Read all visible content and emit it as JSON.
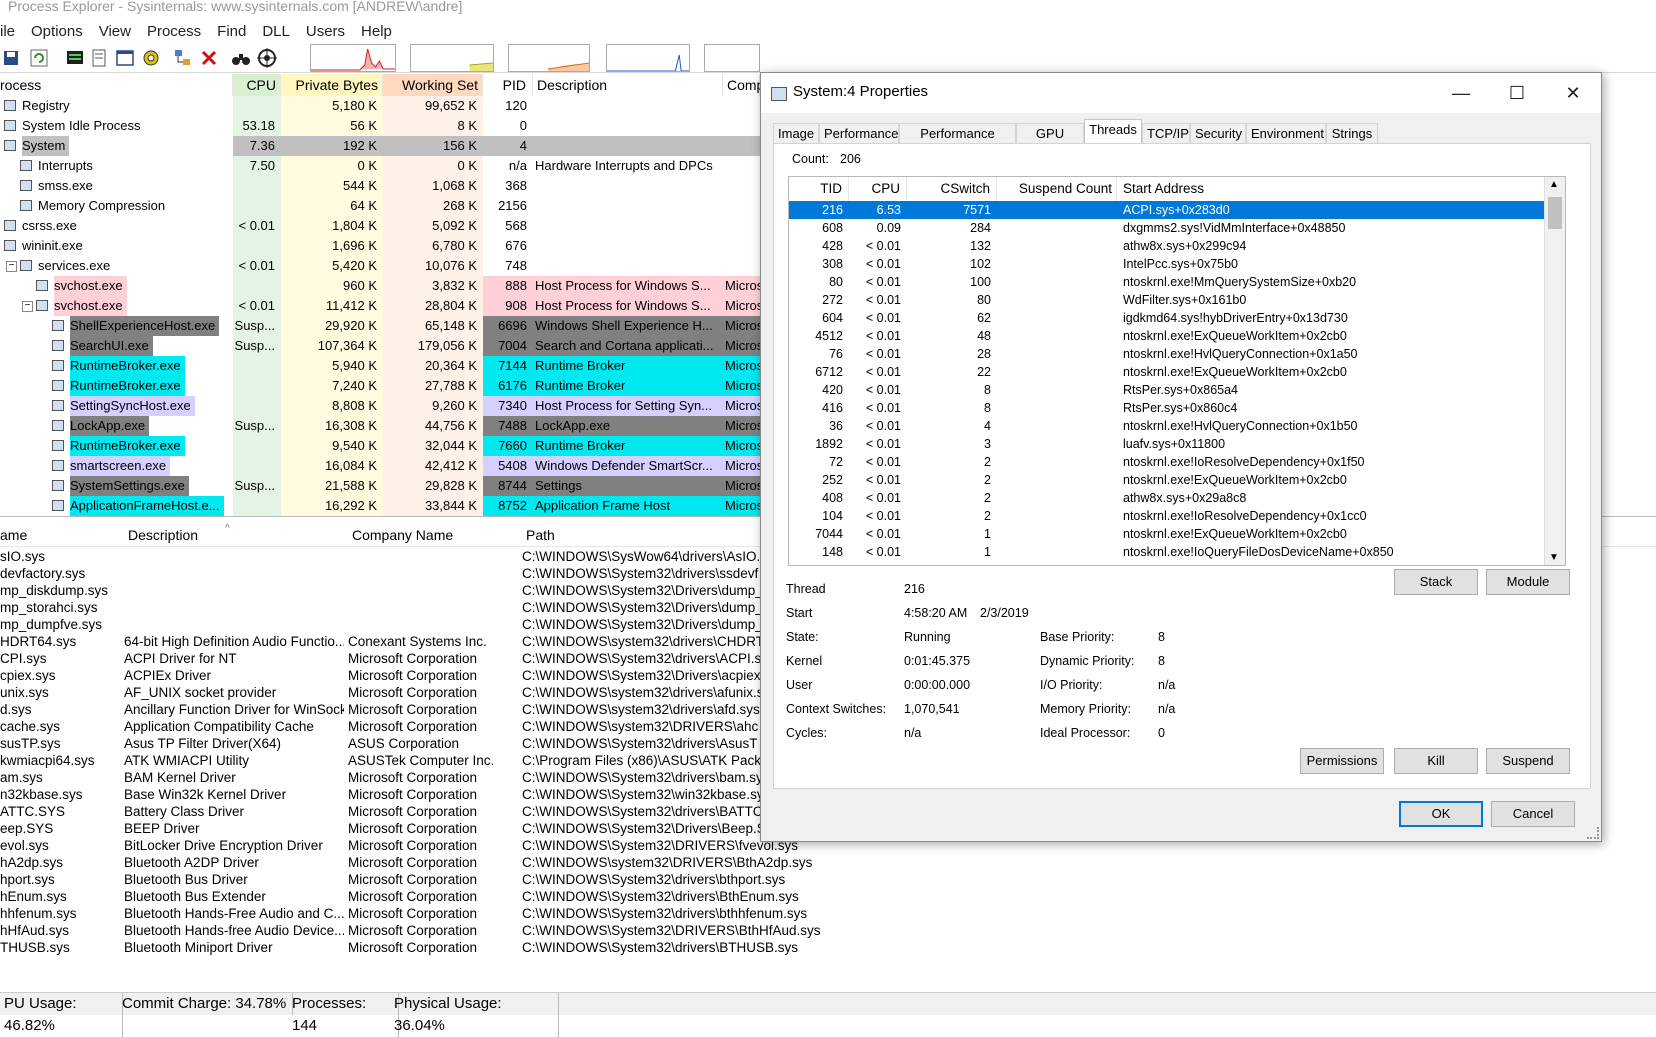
{
  "app": {
    "title": "Process Explorer - Sysinternals: www.sysinternals.com [ANDREW\\andre]",
    "menu": [
      "ile",
      "Options",
      "View",
      "Process",
      "Find",
      "DLL",
      "Users",
      "Help"
    ]
  },
  "colors": {
    "cpu_bg": "#e4f4e4",
    "private_bg": "#fffbe0",
    "working_bg": "#fff0e8",
    "system_row": "#c0c0c0",
    "service_pink": "#ffd0d8",
    "suspended_gray": "#808080",
    "immersive_cyan": "#00e8f0",
    "own_lavender": "#d4d0ff",
    "selection": "#0078d7"
  },
  "process_table": {
    "headers": {
      "process": "rocess",
      "cpu": "CPU",
      "private": "Private Bytes",
      "working": "Working Set",
      "pid": "PID",
      "description": "Description",
      "company": "Comp"
    },
    "rows": [
      {
        "name": "Registry",
        "indent": 0,
        "cpu": "",
        "private": "5,180 K",
        "working": "99,652 K",
        "pid": "120",
        "desc": "",
        "company": "",
        "style": "none"
      },
      {
        "name": "System Idle Process",
        "indent": 0,
        "cpu": "53.18",
        "private": "56 K",
        "working": "8 K",
        "pid": "0",
        "desc": "",
        "company": "",
        "style": "none"
      },
      {
        "name": "System",
        "indent": 0,
        "cpu": "7.36",
        "private": "192 K",
        "working": "156 K",
        "pid": "4",
        "desc": "",
        "company": "",
        "style": "system"
      },
      {
        "name": "Interrupts",
        "indent": 1,
        "cpu": "7.50",
        "private": "0 K",
        "working": "0 K",
        "pid": "n/a",
        "desc": "Hardware Interrupts and DPCs",
        "company": "",
        "style": "none"
      },
      {
        "name": "smss.exe",
        "indent": 1,
        "cpu": "",
        "private": "544 K",
        "working": "1,068 K",
        "pid": "368",
        "desc": "",
        "company": "",
        "style": "none"
      },
      {
        "name": "Memory Compression",
        "indent": 1,
        "cpu": "",
        "private": "64 K",
        "working": "268 K",
        "pid": "2156",
        "desc": "",
        "company": "",
        "style": "none"
      },
      {
        "name": "csrss.exe",
        "indent": 0,
        "cpu": "< 0.01",
        "private": "1,804 K",
        "working": "5,092 K",
        "pid": "568",
        "desc": "",
        "company": "",
        "style": "none"
      },
      {
        "name": "wininit.exe",
        "indent": 0,
        "cpu": "",
        "private": "1,696 K",
        "working": "6,780 K",
        "pid": "676",
        "desc": "",
        "company": "",
        "style": "none"
      },
      {
        "name": "services.exe",
        "indent": 1,
        "cpu": "< 0.01",
        "private": "5,420 K",
        "working": "10,076 K",
        "pid": "748",
        "desc": "",
        "company": "",
        "style": "none"
      },
      {
        "name": "svchost.exe",
        "indent": 2,
        "cpu": "",
        "private": "960 K",
        "working": "3,832 K",
        "pid": "888",
        "desc": "Host Process for Windows S...",
        "company": "Micros",
        "style": "service"
      },
      {
        "name": "svchost.exe",
        "indent": 2,
        "cpu": "< 0.01",
        "private": "11,412 K",
        "working": "28,804 K",
        "pid": "908",
        "desc": "Host Process for Windows S...",
        "company": "Micros",
        "style": "service"
      },
      {
        "name": "ShellExperienceHost.exe",
        "indent": 3,
        "cpu": "Susp...",
        "private": "29,920 K",
        "working": "65,148 K",
        "pid": "6696",
        "desc": "Windows Shell Experience H...",
        "company": "Micros",
        "style": "suspended"
      },
      {
        "name": "SearchUI.exe",
        "indent": 3,
        "cpu": "Susp...",
        "private": "107,364 K",
        "working": "179,056 K",
        "pid": "7004",
        "desc": "Search and Cortana applicati...",
        "company": "Micros",
        "style": "suspended"
      },
      {
        "name": "RuntimeBroker.exe",
        "indent": 3,
        "cpu": "",
        "private": "5,940 K",
        "working": "20,364 K",
        "pid": "7144",
        "desc": "Runtime Broker",
        "company": "Micros",
        "style": "immersive"
      },
      {
        "name": "RuntimeBroker.exe",
        "indent": 3,
        "cpu": "",
        "private": "7,240 K",
        "working": "27,788 K",
        "pid": "6176",
        "desc": "Runtime Broker",
        "company": "Micros",
        "style": "immersive"
      },
      {
        "name": "SettingSyncHost.exe",
        "indent": 3,
        "cpu": "",
        "private": "8,808 K",
        "working": "9,260 K",
        "pid": "7340",
        "desc": "Host Process for Setting Syn...",
        "company": "Micros",
        "style": "own"
      },
      {
        "name": "LockApp.exe",
        "indent": 3,
        "cpu": "Susp...",
        "private": "16,308 K",
        "working": "44,756 K",
        "pid": "7488",
        "desc": "LockApp.exe",
        "company": "Micros",
        "style": "suspended"
      },
      {
        "name": "RuntimeBroker.exe",
        "indent": 3,
        "cpu": "",
        "private": "9,540 K",
        "working": "32,044 K",
        "pid": "7660",
        "desc": "Runtime Broker",
        "company": "Micros",
        "style": "immersive"
      },
      {
        "name": "smartscreen.exe",
        "indent": 3,
        "cpu": "",
        "private": "16,084 K",
        "working": "42,412 K",
        "pid": "5408",
        "desc": "Windows Defender SmartScr...",
        "company": "Micros",
        "style": "own"
      },
      {
        "name": "SystemSettings.exe",
        "indent": 3,
        "cpu": "Susp...",
        "private": "21,588 K",
        "working": "29,828 K",
        "pid": "8744",
        "desc": "Settings",
        "company": "Micros",
        "style": "suspended"
      },
      {
        "name": "ApplicationFrameHost.e...",
        "indent": 3,
        "cpu": "",
        "private": "16,292 K",
        "working": "33,844 K",
        "pid": "8752",
        "desc": "Application Frame Host",
        "company": "Micros",
        "style": "immersive"
      }
    ]
  },
  "dll_table": {
    "headers": {
      "name": "ame",
      "description": "Description",
      "company": "Company Name",
      "path": "Path"
    },
    "rows": [
      {
        "name": "sIO.sys",
        "desc": "",
        "company": "",
        "path": "C:\\WINDOWS\\SysWow64\\drivers\\AsIO."
      },
      {
        "name": "devfactory.sys",
        "desc": "",
        "company": "",
        "path": "C:\\WINDOWS\\System32\\drivers\\ssdevf"
      },
      {
        "name": "mp_diskdump.sys",
        "desc": "",
        "company": "",
        "path": "C:\\WINDOWS\\System32\\Drivers\\dump_"
      },
      {
        "name": "mp_storahci.sys",
        "desc": "",
        "company": "",
        "path": "C:\\WINDOWS\\System32\\Drivers\\dump_"
      },
      {
        "name": "mp_dumpfve.sys",
        "desc": "",
        "company": "",
        "path": "C:\\WINDOWS\\System32\\Drivers\\dump_"
      },
      {
        "name": "HDRT64.sys",
        "desc": "64-bit High Definition Audio Functio...",
        "company": "Conexant Systems Inc.",
        "path": "C:\\WINDOWS\\system32\\drivers\\CHDRT"
      },
      {
        "name": "CPI.sys",
        "desc": "ACPI Driver for NT",
        "company": "Microsoft Corporation",
        "path": "C:\\WINDOWS\\System32\\drivers\\ACPI.s"
      },
      {
        "name": "cpiex.sys",
        "desc": "ACPIEx Driver",
        "company": "Microsoft Corporation",
        "path": "C:\\WINDOWS\\System32\\Drivers\\acpiex"
      },
      {
        "name": "unix.sys",
        "desc": "AF_UNIX socket provider",
        "company": "Microsoft Corporation",
        "path": "C:\\WINDOWS\\system32\\drivers\\afunix.s"
      },
      {
        "name": "d.sys",
        "desc": "Ancillary Function Driver for WinSock",
        "company": "Microsoft Corporation",
        "path": "C:\\WINDOWS\\system32\\drivers\\afd.sys"
      },
      {
        "name": "cache.sys",
        "desc": "Application Compatibility Cache",
        "company": "Microsoft Corporation",
        "path": "C:\\WINDOWS\\system32\\DRIVERS\\ahc"
      },
      {
        "name": "susTP.sys",
        "desc": "Asus TP Filter Driver(X64)",
        "company": "ASUS Corporation",
        "path": "C:\\WINDOWS\\System32\\drivers\\AsusT"
      },
      {
        "name": "kwmiacpi64.sys",
        "desc": "ATK WMIACPI Utility",
        "company": "ASUSTek Computer Inc.",
        "path": "C:\\Program Files (x86)\\ASUS\\ATK Pack"
      },
      {
        "name": "am.sys",
        "desc": "BAM Kernel Driver",
        "company": "Microsoft Corporation",
        "path": "C:\\WINDOWS\\System32\\drivers\\bam.sy"
      },
      {
        "name": "n32kbase.sys",
        "desc": "Base Win32k Kernel Driver",
        "company": "Microsoft Corporation",
        "path": "C:\\WINDOWS\\System32\\win32kbase.sy"
      },
      {
        "name": "ATTC.SYS",
        "desc": "Battery Class Driver",
        "company": "Microsoft Corporation",
        "path": "C:\\WINDOWS\\System32\\drivers\\BATTC"
      },
      {
        "name": "eep.SYS",
        "desc": "BEEP Driver",
        "company": "Microsoft Corporation",
        "path": "C:\\WINDOWS\\System32\\Drivers\\Beep.SYS"
      },
      {
        "name": "evol.sys",
        "desc": "BitLocker Drive Encryption Driver",
        "company": "Microsoft Corporation",
        "path": "C:\\WINDOWS\\System32\\DRIVERS\\fvevol.sys"
      },
      {
        "name": "hA2dp.sys",
        "desc": "Bluetooth A2DP Driver",
        "company": "Microsoft Corporation",
        "path": "C:\\WINDOWS\\system32\\DRIVERS\\BthA2dp.sys"
      },
      {
        "name": "hport.sys",
        "desc": "Bluetooth Bus Driver",
        "company": "Microsoft Corporation",
        "path": "C:\\WINDOWS\\System32\\drivers\\bthport.sys"
      },
      {
        "name": "hEnum.sys",
        "desc": "Bluetooth Bus Extender",
        "company": "Microsoft Corporation",
        "path": "C:\\WINDOWS\\System32\\drivers\\BthEnum.sys"
      },
      {
        "name": "hhfenum.sys",
        "desc": "Bluetooth Hands-Free Audio and C...",
        "company": "Microsoft Corporation",
        "path": "C:\\WINDOWS\\System32\\drivers\\bthhfenum.sys"
      },
      {
        "name": "hHfAud.sys",
        "desc": "Bluetooth Hands-free Audio Device...",
        "company": "Microsoft Corporation",
        "path": "C:\\WINDOWS\\System32\\DRIVERS\\BthHfAud.sys"
      },
      {
        "name": "THUSB.sys",
        "desc": "Bluetooth Miniport Driver",
        "company": "Microsoft Corporation",
        "path": "C:\\WINDOWS\\System32\\drivers\\BTHUSB.sys"
      }
    ]
  },
  "status": {
    "cpu_usage": "PU Usage: 46.82%",
    "commit": "Commit Charge: 34.78%",
    "processes": "Processes: 144",
    "physical": "Physical Usage: 36.04%"
  },
  "dialog": {
    "title": "System:4 Properties",
    "tabs": [
      "Image",
      "Performance",
      "Performance Graph",
      "GPU Graph",
      "Threads",
      "TCP/IP",
      "Security",
      "Environment",
      "Strings"
    ],
    "active_tab": "Threads",
    "count_label": "Count:",
    "count_value": "206",
    "thread_headers": {
      "tid": "TID",
      "cpu": "CPU",
      "cswitch": "CSwitch Delta",
      "suspend": "Suspend Count",
      "start": "Start Address"
    },
    "threads": [
      {
        "tid": "216",
        "cpu": "6.53",
        "cswitch": "7571",
        "start": "ACPI.sys+0x283d0",
        "selected": true
      },
      {
        "tid": "608",
        "cpu": "0.09",
        "cswitch": "284",
        "start": "dxgmms2.sys!VidMmInterface+0x48850"
      },
      {
        "tid": "428",
        "cpu": "< 0.01",
        "cswitch": "132",
        "start": "athw8x.sys+0x299c94"
      },
      {
        "tid": "308",
        "cpu": "< 0.01",
        "cswitch": "102",
        "start": "IntelPcc.sys+0x75b0"
      },
      {
        "tid": "80",
        "cpu": "< 0.01",
        "cswitch": "100",
        "start": "ntoskrnl.exe!MmQuerySystemSize+0xb20"
      },
      {
        "tid": "272",
        "cpu": "< 0.01",
        "cswitch": "80",
        "start": "WdFilter.sys+0x161b0"
      },
      {
        "tid": "604",
        "cpu": "< 0.01",
        "cswitch": "62",
        "start": "igdkmd64.sys!hybDriverEntry+0x13d730"
      },
      {
        "tid": "4512",
        "cpu": "< 0.01",
        "cswitch": "48",
        "start": "ntoskrnl.exe!ExQueueWorkItem+0x2cb0"
      },
      {
        "tid": "76",
        "cpu": "< 0.01",
        "cswitch": "28",
        "start": "ntoskrnl.exe!HvlQueryConnection+0x1a50"
      },
      {
        "tid": "6712",
        "cpu": "< 0.01",
        "cswitch": "22",
        "start": "ntoskrnl.exe!ExQueueWorkItem+0x2cb0"
      },
      {
        "tid": "420",
        "cpu": "< 0.01",
        "cswitch": "8",
        "start": "RtsPer.sys+0x865a4"
      },
      {
        "tid": "416",
        "cpu": "< 0.01",
        "cswitch": "8",
        "start": "RtsPer.sys+0x860c4"
      },
      {
        "tid": "36",
        "cpu": "< 0.01",
        "cswitch": "4",
        "start": "ntoskrnl.exe!HvlQueryConnection+0x1b50"
      },
      {
        "tid": "1892",
        "cpu": "< 0.01",
        "cswitch": "3",
        "start": "luafv.sys+0x11800"
      },
      {
        "tid": "72",
        "cpu": "< 0.01",
        "cswitch": "2",
        "start": "ntoskrnl.exe!IoResolveDependency+0x1f50"
      },
      {
        "tid": "252",
        "cpu": "< 0.01",
        "cswitch": "2",
        "start": "ntoskrnl.exe!ExQueueWorkItem+0x2cb0"
      },
      {
        "tid": "408",
        "cpu": "< 0.01",
        "cswitch": "2",
        "start": "athw8x.sys+0x29a8c8"
      },
      {
        "tid": "104",
        "cpu": "< 0.01",
        "cswitch": "2",
        "start": "ntoskrnl.exe!IoResolveDependency+0x1cc0"
      },
      {
        "tid": "7044",
        "cpu": "< 0.01",
        "cswitch": "1",
        "start": "ntoskrnl.exe!ExQueueWorkItem+0x2cb0"
      },
      {
        "tid": "148",
        "cpu": "< 0.01",
        "cswitch": "1",
        "start": "ntoskrnl.exe!IoQueryFileDosDeviceName+0x850"
      }
    ],
    "details": {
      "thread_label": "Thread",
      "thread_value": "216",
      "start_label": "Start",
      "start_time": "4:58:20 AM",
      "start_date": "2/3/2019",
      "state_label": "State:",
      "state_value": "Running",
      "kernel_label": "Kernel",
      "kernel_value": "0:01:45.375",
      "user_label": "User",
      "user_value": "0:00:00.000",
      "ctx_label": "Context Switches:",
      "ctx_value": "1,070,541",
      "cycles_label": "Cycles:",
      "cycles_value": "n/a",
      "base_prio_label": "Base Priority:",
      "base_prio_value": "8",
      "dyn_prio_label": "Dynamic Priority:",
      "dyn_prio_value": "8",
      "io_prio_label": "I/O Priority:",
      "io_prio_value": "n/a",
      "mem_prio_label": "Memory Priority:",
      "mem_prio_value": "n/a",
      "ideal_label": "Ideal Processor:",
      "ideal_value": "0"
    },
    "buttons": {
      "stack": "Stack",
      "module": "Module",
      "permissions": "Permissions",
      "kill": "Kill",
      "suspend": "Suspend",
      "ok": "OK",
      "cancel": "Cancel"
    }
  }
}
